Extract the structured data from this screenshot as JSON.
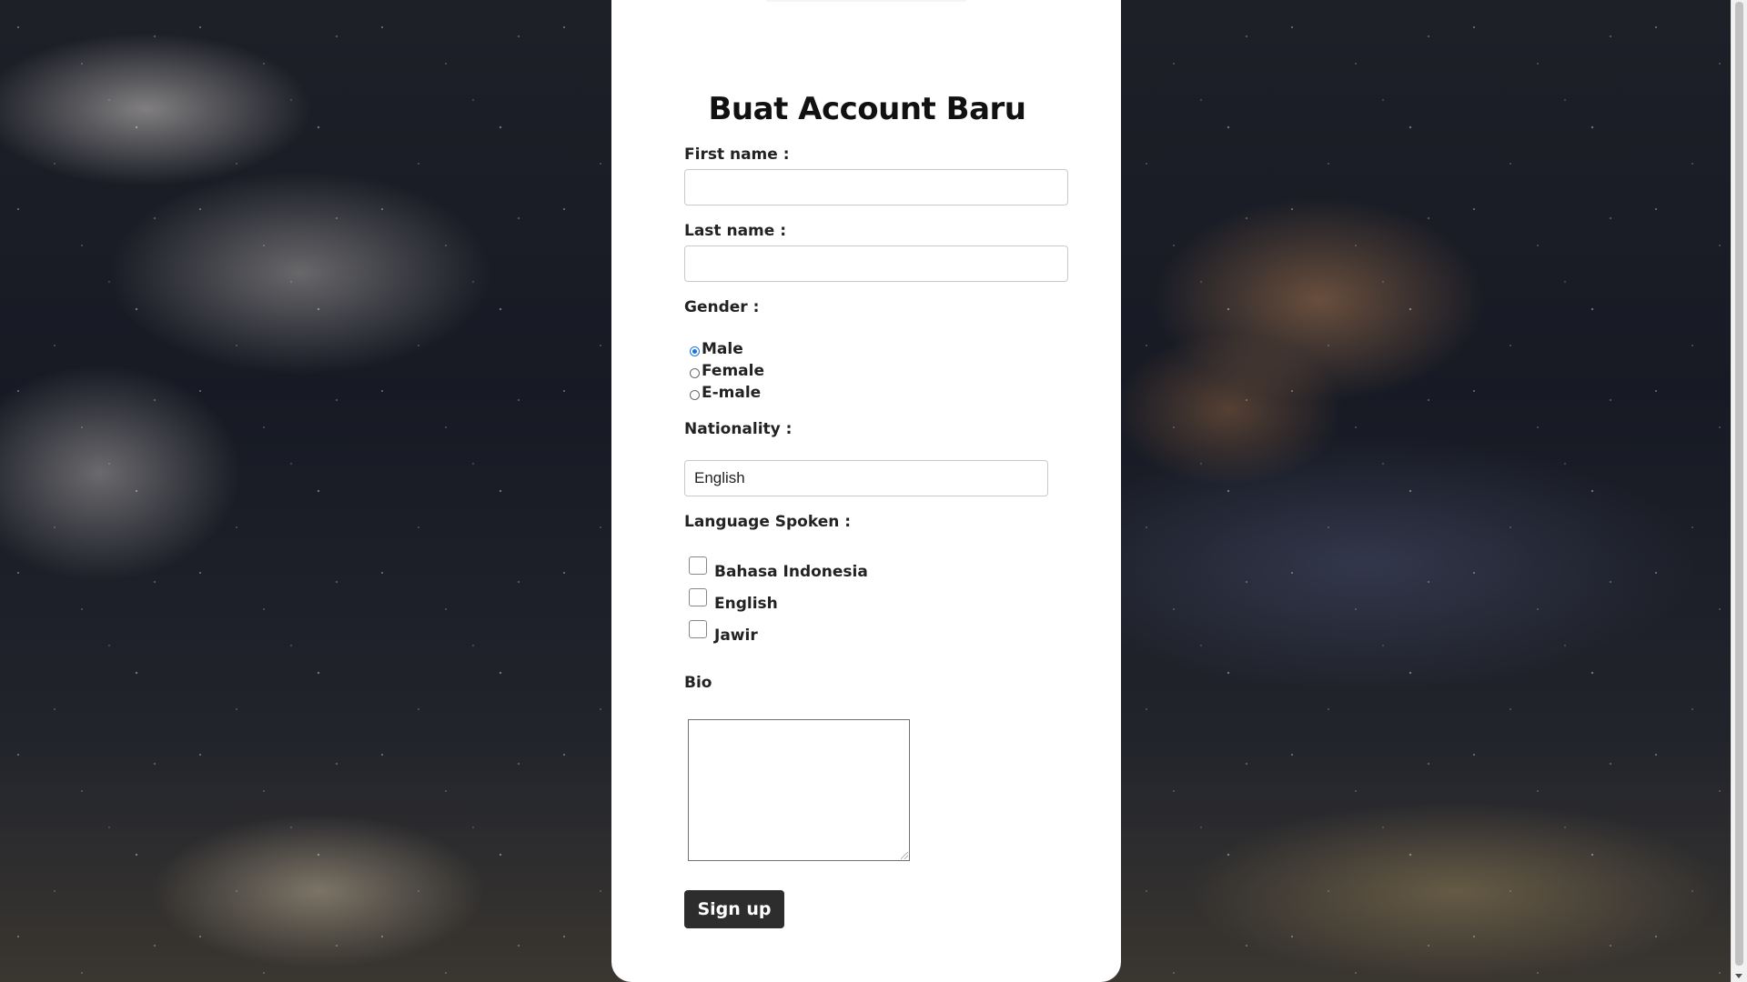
{
  "page": {
    "title": "Buat Account Baru"
  },
  "form": {
    "first_name": {
      "label": "First name :",
      "value": ""
    },
    "last_name": {
      "label": "Last name :",
      "value": ""
    },
    "gender": {
      "label": "Gender :",
      "options": [
        "Male",
        "Female",
        "E-male"
      ],
      "selected": "Male"
    },
    "nationality": {
      "label": "Nationality :",
      "selected": "English"
    },
    "languages": {
      "label": "Language Spoken :",
      "options": [
        "Bahasa Indonesia",
        "English",
        "Jawir"
      ],
      "checked": []
    },
    "bio": {
      "label": "Bio",
      "value": ""
    },
    "submit_label": "Sign up"
  },
  "colors": {
    "card_bg": "#ffffff",
    "button_bg": "#2d2d2d",
    "radio_accent": "#1a73e8"
  }
}
